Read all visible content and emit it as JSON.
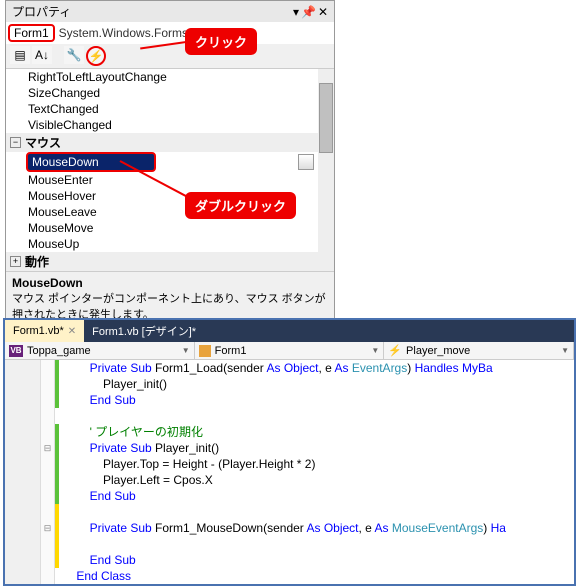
{
  "prop": {
    "title": "プロパティ",
    "selected_object": "Form1",
    "object_type": "System.Windows.Forms.Form",
    "events": {
      "above": [
        "RightToLeftLayoutChange",
        "SizeChanged",
        "TextChanged",
        "VisibleChanged"
      ],
      "cat_mouse": "マウス",
      "selected": "MouseDown",
      "below": [
        "MouseEnter",
        "MouseHover",
        "MouseLeave",
        "MouseMove",
        "MouseUp"
      ],
      "cat_action": "動作"
    },
    "desc_name": "MouseDown",
    "desc_text": "マウス ポインターがコンポーネント上にあり、マウス ボタンが押されたときに発生します。"
  },
  "callouts": {
    "click": "クリック",
    "dblclick": "ダブルクリック"
  },
  "editor": {
    "tabs": [
      {
        "label": "Form1.vb*",
        "active": true
      },
      {
        "label": "Form1.vb [デザイン]*",
        "active": false
      }
    ],
    "nav": {
      "project": "Toppa_game",
      "class": "Form1",
      "member": "Player_move"
    },
    "code": [
      {
        "ind": 2,
        "cb": "g",
        "fold": "",
        "seg": [
          {
            "t": "Private Sub",
            "c": "kw"
          },
          {
            "t": " Form1_Load(sender ",
            "c": "nm"
          },
          {
            "t": "As",
            "c": "kw"
          },
          {
            "t": " ",
            "c": "nm"
          },
          {
            "t": "Object",
            "c": "kw"
          },
          {
            "t": ", e ",
            "c": "nm"
          },
          {
            "t": "As",
            "c": "kw"
          },
          {
            "t": " ",
            "c": "nm"
          },
          {
            "t": "EventArgs",
            "c": "typ"
          },
          {
            "t": ") ",
            "c": "nm"
          },
          {
            "t": "Handles",
            "c": "kw"
          },
          {
            "t": " ",
            "c": "nm"
          },
          {
            "t": "MyBa",
            "c": "kw"
          }
        ]
      },
      {
        "ind": 3,
        "cb": "g",
        "fold": "",
        "seg": [
          {
            "t": "Player_init()",
            "c": "nm"
          }
        ]
      },
      {
        "ind": 2,
        "cb": "g",
        "fold": "",
        "seg": [
          {
            "t": "End Sub",
            "c": "kw"
          }
        ]
      },
      {
        "ind": 0,
        "cb": "n",
        "fold": "",
        "seg": []
      },
      {
        "ind": 2,
        "cb": "g",
        "fold": "",
        "seg": [
          {
            "t": "' プレイヤーの初期化",
            "c": "cmt"
          }
        ]
      },
      {
        "ind": 2,
        "cb": "g",
        "fold": "⊟",
        "seg": [
          {
            "t": "Private Sub",
            "c": "kw"
          },
          {
            "t": " Player_init()",
            "c": "nm"
          }
        ]
      },
      {
        "ind": 3,
        "cb": "g",
        "fold": "",
        "seg": [
          {
            "t": "Player.Top = Height - (Player.Height * 2)",
            "c": "nm"
          }
        ]
      },
      {
        "ind": 3,
        "cb": "g",
        "fold": "",
        "seg": [
          {
            "t": "Player.Left = Cpos.X",
            "c": "nm"
          }
        ]
      },
      {
        "ind": 2,
        "cb": "g",
        "fold": "",
        "seg": [
          {
            "t": "End Sub",
            "c": "kw"
          }
        ]
      },
      {
        "ind": 0,
        "cb": "y",
        "fold": "",
        "seg": []
      },
      {
        "ind": 2,
        "cb": "y",
        "fold": "⊟",
        "seg": [
          {
            "t": "Private Sub",
            "c": "kw"
          },
          {
            "t": " Form1_MouseDown(sender ",
            "c": "nm"
          },
          {
            "t": "As",
            "c": "kw"
          },
          {
            "t": " ",
            "c": "nm"
          },
          {
            "t": "Object",
            "c": "kw"
          },
          {
            "t": ", e ",
            "c": "nm"
          },
          {
            "t": "As",
            "c": "kw"
          },
          {
            "t": " ",
            "c": "nm"
          },
          {
            "t": "MouseEventArgs",
            "c": "typ"
          },
          {
            "t": ") ",
            "c": "nm"
          },
          {
            "t": "Ha",
            "c": "kw"
          }
        ]
      },
      {
        "ind": 0,
        "cb": "y",
        "fold": "",
        "seg": []
      },
      {
        "ind": 2,
        "cb": "y",
        "fold": "",
        "seg": [
          {
            "t": "End Sub",
            "c": "kw"
          }
        ]
      },
      {
        "ind": 1,
        "cb": "n",
        "fold": "",
        "seg": [
          {
            "t": "End Class",
            "c": "kw"
          }
        ]
      }
    ]
  }
}
